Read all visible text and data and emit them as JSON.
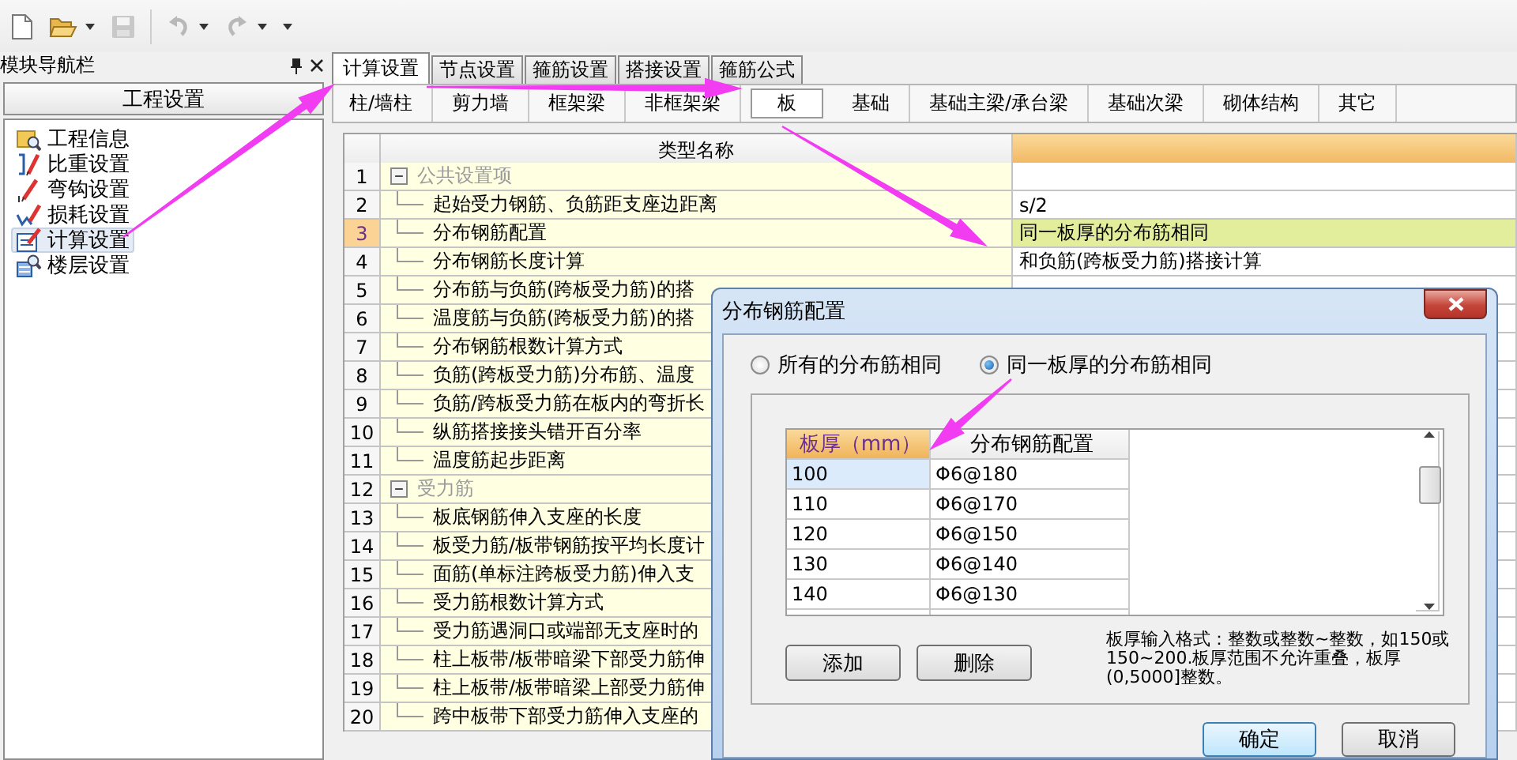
{
  "toolbar": [
    {
      "kind": "new",
      "disabled": false,
      "dropdown": false
    },
    {
      "kind": "open",
      "disabled": false,
      "dropdown": true
    },
    {
      "kind": "save",
      "disabled": true,
      "dropdown": false
    },
    {
      "kind": "undo",
      "disabled": true,
      "dropdown": true
    },
    {
      "kind": "redo",
      "disabled": true,
      "dropdown": true
    },
    {
      "kind": "more"
    }
  ],
  "nav_panel": {
    "title": "模块导航栏",
    "section": "工程设置",
    "items": [
      {
        "label": "工程信息",
        "selected": false
      },
      {
        "label": "比重设置",
        "selected": false
      },
      {
        "label": "弯钩设置",
        "selected": false
      },
      {
        "label": "损耗设置",
        "selected": false
      },
      {
        "label": "计算设置",
        "selected": true
      },
      {
        "label": "楼层设置",
        "selected": false
      }
    ]
  },
  "tabs": [
    {
      "label": "计算设置",
      "selected": true
    },
    {
      "label": "节点设置",
      "selected": false
    },
    {
      "label": "箍筋设置",
      "selected": false
    },
    {
      "label": "搭接设置",
      "selected": false
    },
    {
      "label": "箍筋公式",
      "selected": false
    }
  ],
  "sub_tabs": [
    {
      "label": "柱/墙柱",
      "selected": false
    },
    {
      "label": "剪力墙",
      "selected": false
    },
    {
      "label": "框架梁",
      "selected": false
    },
    {
      "label": "非框架梁",
      "selected": false
    },
    {
      "label": "板",
      "selected": true
    },
    {
      "label": "基础",
      "selected": false
    },
    {
      "label": "基础主梁/承台梁",
      "selected": false
    },
    {
      "label": "基础次梁",
      "selected": false
    },
    {
      "label": "砌体结构",
      "selected": false
    },
    {
      "label": "其它",
      "selected": false
    }
  ],
  "grid": {
    "columns": [
      "类型名称"
    ],
    "rows": [
      {
        "number": "1",
        "kind": "group",
        "expanded": true,
        "name": "公共设置项",
        "selected": false
      },
      {
        "number": "2",
        "kind": "item",
        "name": "起始受力钢筋、负筋距支座边距离",
        "value": "s/2",
        "selected": false
      },
      {
        "number": "3",
        "kind": "item",
        "name": "分布钢筋配置",
        "value": "同一板厚的分布筋相同",
        "selected": true
      },
      {
        "number": "4",
        "kind": "item",
        "name": "分布钢筋长度计算",
        "value": "和负筋(跨板受力筋)搭接计算",
        "selected": false
      },
      {
        "number": "5",
        "kind": "item",
        "name": "分布筋与负筋(跨板受力筋)的搭",
        "selected": false
      },
      {
        "number": "6",
        "kind": "item",
        "name": "温度筋与负筋(跨板受力筋)的搭",
        "selected": false
      },
      {
        "number": "7",
        "kind": "item",
        "name": "分布钢筋根数计算方式",
        "selected": false
      },
      {
        "number": "8",
        "kind": "item",
        "name": "负筋(跨板受力筋)分布筋、温度",
        "selected": false
      },
      {
        "number": "9",
        "kind": "item",
        "name": "负筋/跨板受力筋在板内的弯折长",
        "selected": false
      },
      {
        "number": "10",
        "kind": "item",
        "name": "纵筋搭接接头错开百分率",
        "selected": false
      },
      {
        "number": "11",
        "kind": "item",
        "name": "温度筋起步距离",
        "selected": false
      },
      {
        "number": "12",
        "kind": "group",
        "expanded": true,
        "name": "受力筋",
        "selected": false
      },
      {
        "number": "13",
        "kind": "item",
        "name": "板底钢筋伸入支座的长度",
        "selected": false
      },
      {
        "number": "14",
        "kind": "item",
        "name": "板受力筋/板带钢筋按平均长度计",
        "selected": false
      },
      {
        "number": "15",
        "kind": "item",
        "name": "面筋(单标注跨板受力筋)伸入支",
        "selected": false
      },
      {
        "number": "16",
        "kind": "item",
        "name": "受力筋根数计算方式",
        "selected": false
      },
      {
        "number": "17",
        "kind": "item",
        "name": "受力筋遇洞口或端部无支座时的",
        "selected": false
      },
      {
        "number": "18",
        "kind": "item",
        "name": "柱上板带/板带暗梁下部受力筋伸",
        "selected": false
      },
      {
        "number": "19",
        "kind": "item",
        "name": "柱上板带/板带暗梁上部受力筋伸",
        "selected": false
      },
      {
        "number": "20",
        "kind": "item",
        "name": "跨中板带下部受力筋伸入支座的",
        "selected": false
      }
    ]
  },
  "dialog": {
    "title": "分布钢筋配置",
    "options": [
      {
        "label": "所有的分布筋相同",
        "selected": false
      },
      {
        "label": "同一板厚的分布筋相同",
        "selected": true
      }
    ],
    "table": {
      "columns": [
        "板厚（mm）",
        "分布钢筋配置"
      ],
      "rows": [
        {
          "thickness": "100",
          "config": "Φ6@180",
          "selected": true
        },
        {
          "thickness": "110",
          "config": "Φ6@170",
          "selected": false
        },
        {
          "thickness": "120",
          "config": "Φ6@150",
          "selected": false
        },
        {
          "thickness": "130",
          "config": "Φ6@140",
          "selected": false
        },
        {
          "thickness": "140",
          "config": "Φ6@130",
          "selected": false
        }
      ]
    },
    "buttons": [
      "添加",
      "删除"
    ],
    "hint": "板厚输入格式：整数或整数~整数，如150或150~200.板厚范围不允许重叠，板厚(0,5000]整数。",
    "footer_buttons": [
      {
        "label": "确定",
        "default": true
      },
      {
        "label": "取消",
        "default": false
      }
    ]
  },
  "annotations": [
    {
      "kind": "arrow"
    },
    {
      "kind": "arrow"
    },
    {
      "kind": "arrow"
    },
    {
      "kind": "arrow"
    }
  ]
}
